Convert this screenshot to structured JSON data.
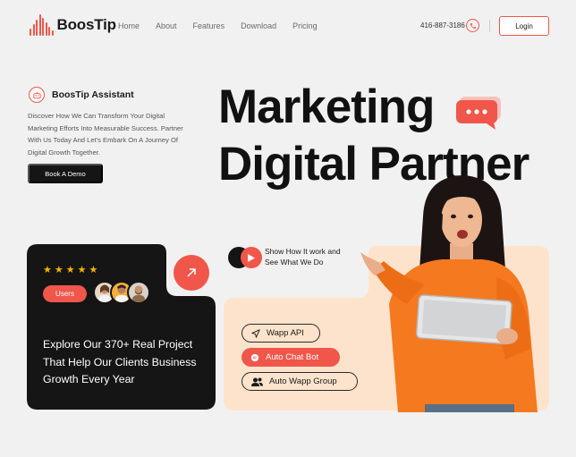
{
  "brand": {
    "name": "BoosTip"
  },
  "nav": {
    "items": [
      "Home",
      "About",
      "Features",
      "Download",
      "Pricing"
    ]
  },
  "header": {
    "phone": "416-887-3186",
    "login_label": "Login"
  },
  "intro": {
    "assistant_title": "BoosTip Assistant",
    "description": "Discover How We Can Transform Your Digital Marketing Efforts Into Measurable Success. Partner With Us Today And Let's Embark On A Journey Of Digital Growth Together.",
    "cta_label": "Book A Demo"
  },
  "hero": {
    "line1": "Marketing",
    "line2": "Digital Partner"
  },
  "stats_card": {
    "rating": 5,
    "users_label": "Users",
    "text": "Explore Our 370+ Real Project That Help Our Clients Business Growth Every Year"
  },
  "feature_card": {
    "play_line1": "Show How It work and",
    "play_line2": "See What We Do",
    "pills": [
      "Wapp API",
      "Auto Chat Bot",
      "Auto Wapp Group"
    ]
  },
  "colors": {
    "accent": "#f0574a",
    "dark": "#151515",
    "peach": "#fde3cc",
    "background": "#f1f1f1"
  }
}
